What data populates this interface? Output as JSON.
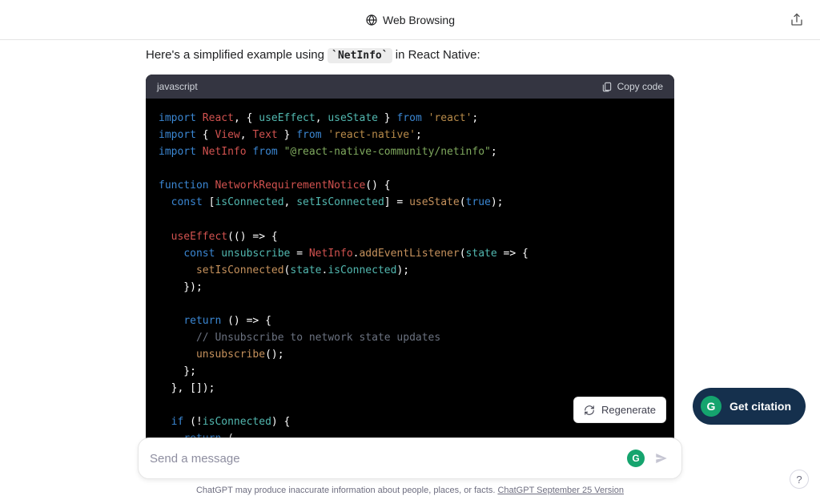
{
  "header": {
    "title": "Web Browsing",
    "icon": "globe-icon"
  },
  "message": {
    "intro_prefix": "Here's a simplified example using ",
    "intro_code": "NetInfo",
    "intro_suffix": " in React Native:"
  },
  "code": {
    "language": "javascript",
    "copy_label": "Copy code",
    "tokens": {
      "import": "import",
      "from": "from",
      "function_kw": "function",
      "const": "const",
      "return": "return",
      "if": "if",
      "React": "React",
      "useEffect": "useEffect",
      "useState": "useState",
      "View": "View",
      "Text": "Text",
      "NetInfo": "NetInfo",
      "react": "'react'",
      "react_native": "'react-native'",
      "netinfo_pkg": "\"@react-native-community/netinfo\"",
      "component": "NetworkRequirementNotice",
      "isConnected": "isConnected",
      "setIsConnected": "setIsConnected",
      "true": "true",
      "unsubscribe": "unsubscribe",
      "addEventListener": "addEventListener",
      "state": "state",
      "comment1": "// Unsubscribe to network state updates"
    }
  },
  "controls": {
    "regenerate": "Regenerate",
    "get_citation": "Get citation"
  },
  "composer": {
    "placeholder": "Send a message"
  },
  "footer": {
    "disclaimer_prefix": "ChatGPT may produce inaccurate information about people, places, or facts. ",
    "version_link": "ChatGPT September 25 Version"
  },
  "help": "?"
}
